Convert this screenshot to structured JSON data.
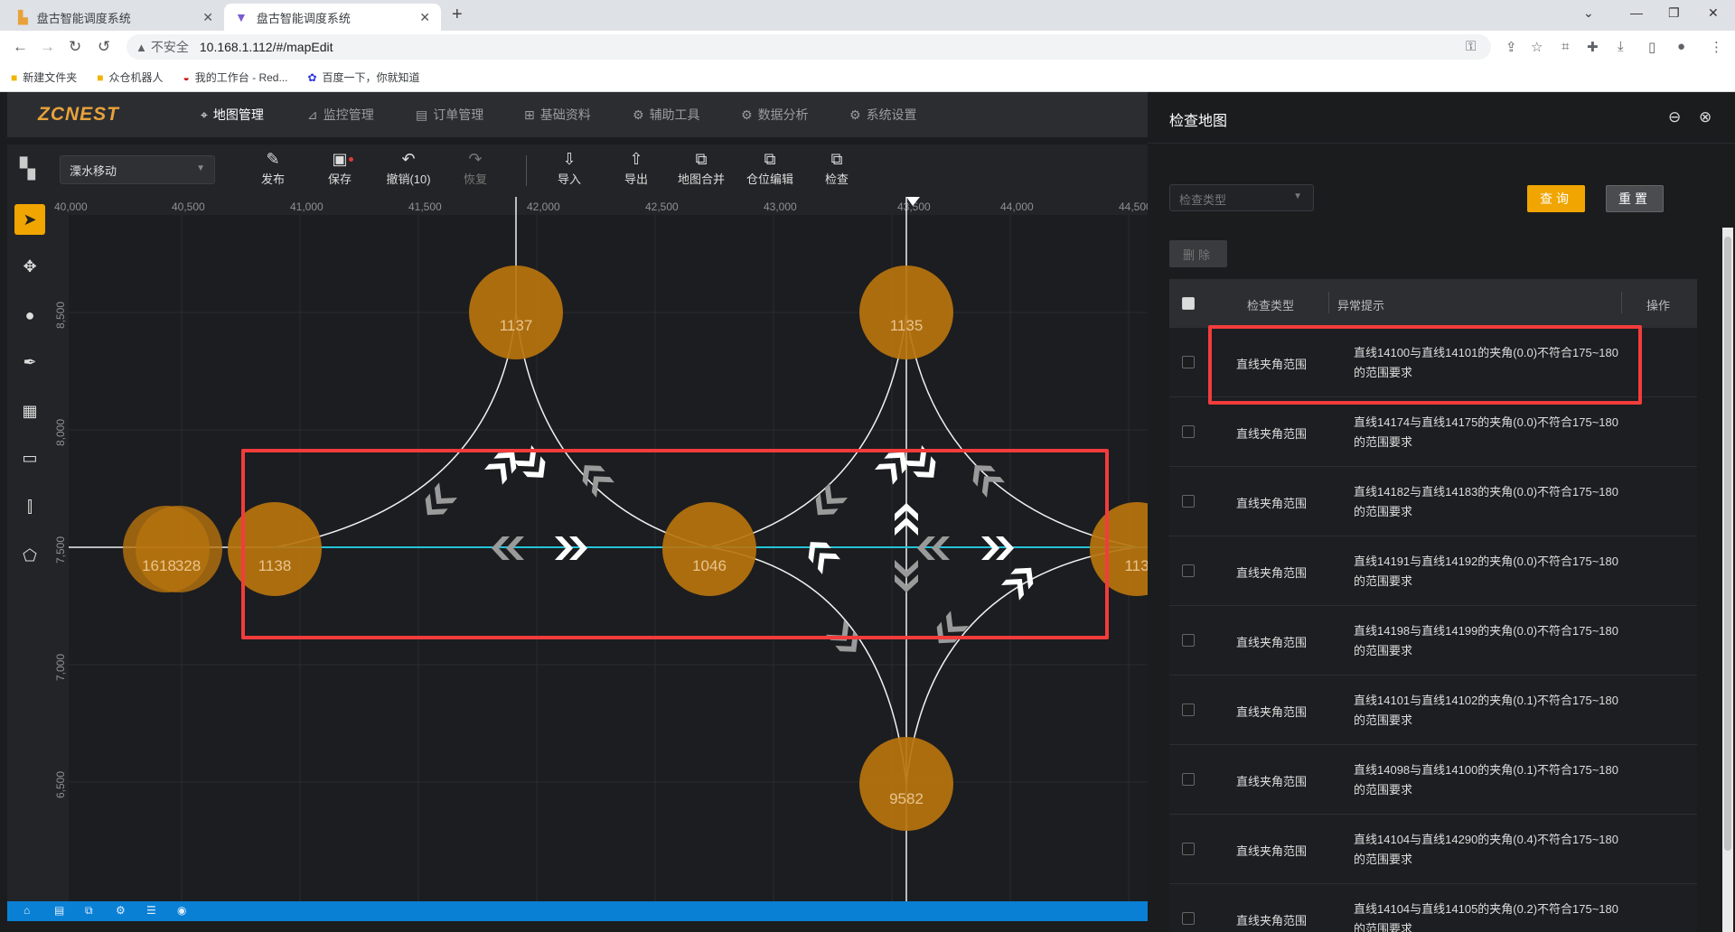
{
  "browser": {
    "tabs": [
      {
        "title": "盘古智能调度系统",
        "active": false
      },
      {
        "title": "盘古智能调度系统",
        "active": true
      }
    ],
    "security_label": "不安全",
    "url": "10.168.1.112/#/mapEdit",
    "bookmarks": [
      "新建文件夹",
      "众仓机器人",
      "我的工作台 - Red...",
      "百度一下，你就知道"
    ]
  },
  "app": {
    "logo": "ZCNEST",
    "menu": [
      {
        "label": "地图管理",
        "active": true
      },
      {
        "label": "监控管理",
        "active": false
      },
      {
        "label": "订单管理",
        "active": false
      },
      {
        "label": "基础资料",
        "active": false
      },
      {
        "label": "辅助工具",
        "active": false
      },
      {
        "label": "数据分析",
        "active": false
      },
      {
        "label": "系统设置",
        "active": false
      }
    ],
    "floor_select": "溧水移动",
    "toolbar": {
      "publish": "发布",
      "save": "保存",
      "undo": "撤销(10)",
      "redo": "恢复",
      "import": "导入",
      "export": "导出",
      "merge": "地图合并",
      "storage_edit": "仓位编辑",
      "check": "检查"
    }
  },
  "map": {
    "x_ticks": [
      "40,000",
      "40,500",
      "41,000",
      "41,500",
      "42,000",
      "42,500",
      "43,000",
      "43,500",
      "44,000",
      "44,500"
    ],
    "y_ticks": [
      "8,500",
      "8,000",
      "7,500",
      "7,000",
      "6,500"
    ],
    "nodes": [
      "1137",
      "1135",
      "1618",
      "328",
      "1138",
      "1046",
      "113",
      "9582"
    ]
  },
  "panel": {
    "title": "检查地图",
    "type_placeholder": "检查类型",
    "query_label": "查询",
    "reset_label": "重置",
    "delete_label": "删除",
    "columns": [
      "检查类型",
      "异常提示",
      "操作"
    ],
    "rows": [
      {
        "type": "直线夹角范围",
        "msg": "直线14100与直线14101的夹角(0.0)不符合175~180的范围要求"
      },
      {
        "type": "直线夹角范围",
        "msg": "直线14174与直线14175的夹角(0.0)不符合175~180的范围要求"
      },
      {
        "type": "直线夹角范围",
        "msg": "直线14182与直线14183的夹角(0.0)不符合175~180的范围要求"
      },
      {
        "type": "直线夹角范围",
        "msg": "直线14191与直线14192的夹角(0.0)不符合175~180的范围要求"
      },
      {
        "type": "直线夹角范围",
        "msg": "直线14198与直线14199的夹角(0.0)不符合175~180的范围要求"
      },
      {
        "type": "直线夹角范围",
        "msg": "直线14101与直线14102的夹角(0.1)不符合175~180的范围要求"
      },
      {
        "type": "直线夹角范围",
        "msg": "直线14098与直线14100的夹角(0.1)不符合175~180的范围要求"
      },
      {
        "type": "直线夹角范围",
        "msg": "直线14104与直线14290的夹角(0.4)不符合175~180的范围要求"
      },
      {
        "type": "直线夹角范围",
        "msg": "直线14104与直线14105的夹角(0.2)不符合175~180的范围要求"
      }
    ]
  }
}
